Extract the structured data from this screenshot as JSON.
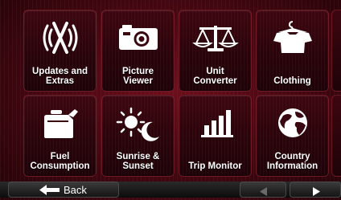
{
  "tiles": [
    {
      "label": "Updates and\nExtras",
      "icon": "wireless-x-icon"
    },
    {
      "label": "Picture\nViewer",
      "icon": "camera-icon"
    },
    {
      "label": "Unit\nConverter",
      "icon": "scales-icon"
    },
    {
      "label": "Clothing",
      "icon": "clothes-hanger-shirt-icon"
    },
    {
      "label": "Fuel\nConsumption",
      "icon": "fuel-can-icon"
    },
    {
      "label": "Sunrise &\nSunset",
      "icon": "sun-moon-icon"
    },
    {
      "label": "Trip Monitor",
      "icon": "bar-chart-icon"
    },
    {
      "label": "Country\nInformation",
      "icon": "globe-icon"
    }
  ],
  "nav": {
    "back_label": "Back",
    "back_icon": "arrow-left-icon",
    "prev_icon": "triangle-left-icon",
    "next_icon": "triangle-right-icon"
  },
  "colors": {
    "background": "#4a0812",
    "tile": "#2a040b",
    "text": "#ffffff",
    "bar": "#151515"
  }
}
